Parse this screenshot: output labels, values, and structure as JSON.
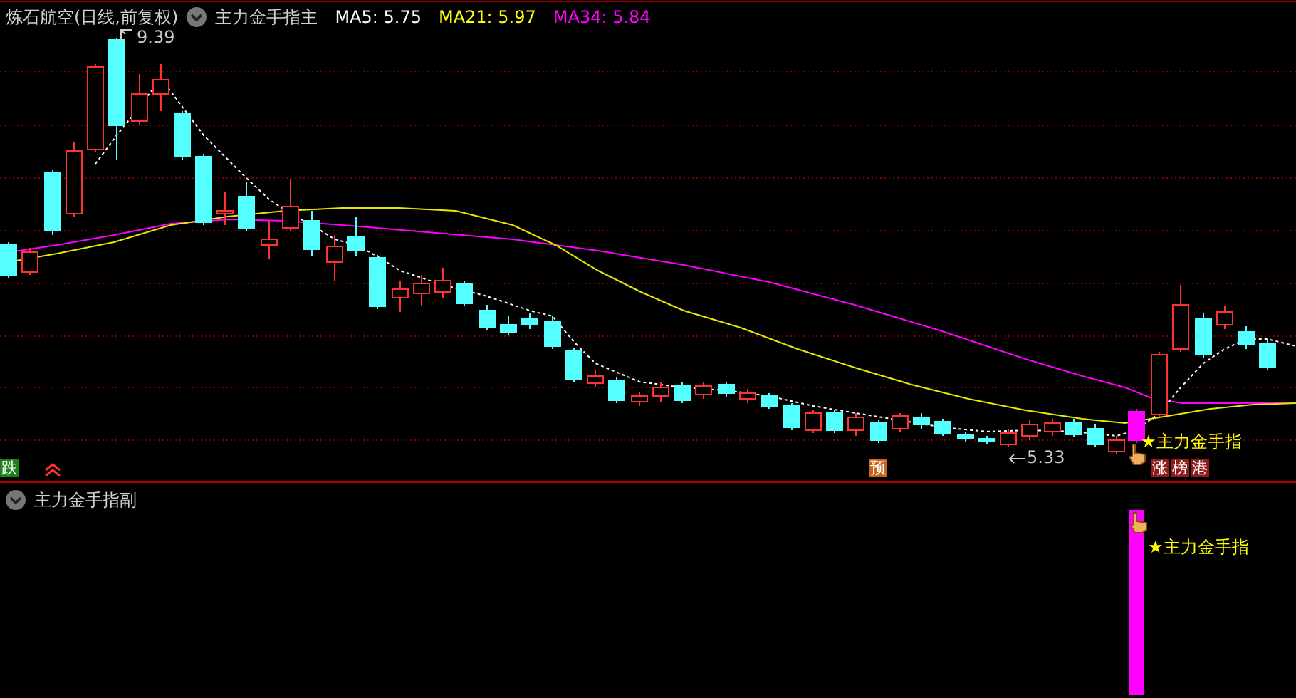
{
  "main_panel": {
    "title": "炼石航空(日线,前复权)",
    "indicator": "主力金手指主",
    "legend": [
      {
        "label": "MA5: 5.75",
        "color": "#ffffff"
      },
      {
        "label": "MA21: 5.97",
        "color": "#ffff00"
      },
      {
        "label": "MA34: 5.84",
        "color": "#ff00ff"
      }
    ],
    "high_label": "9.39",
    "low_label": "5.33",
    "signal_label": "★主力金手指",
    "badges": [
      {
        "text": "跌",
        "color": "#1f7f1f"
      },
      {
        "text": "预",
        "color": "#c8641e"
      },
      {
        "text": "涨",
        "color": "#8e1c1c"
      },
      {
        "text": "榜",
        "color": "#8e1c1c"
      },
      {
        "text": "港",
        "color": "#8e1c1c"
      }
    ]
  },
  "sub_panel": {
    "indicator": "主力金手指副",
    "signal_label": "★主力金手指"
  }
}
